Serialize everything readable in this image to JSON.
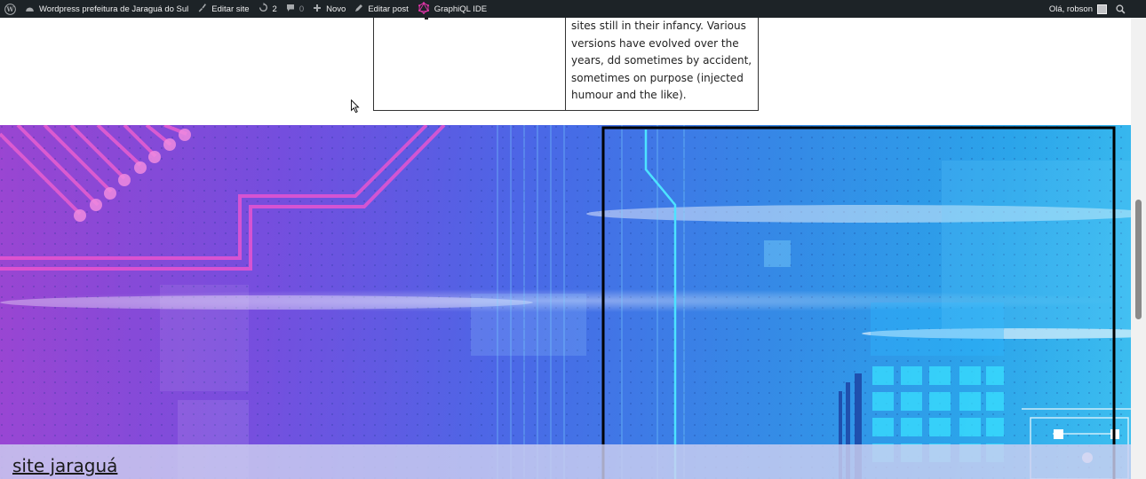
{
  "admin_bar": {
    "wp_logo_icon": "wordpress-icon",
    "site_name": "Wordpress prefeitura de Jaraguá do Sul",
    "edit_site": "Editar site",
    "updates_count": "2",
    "comments_count": "0",
    "new_label": "Novo",
    "edit_post": "Editar post",
    "graphiql": "GraphiQL IDE",
    "greeting": "Olá, robson"
  },
  "table": {
    "right_cell_text": "sites still in their infancy. Various versions have evolved over the years, dd sometimes by accident, sometimes on purpose (injected humour and the like)."
  },
  "hero": {
    "site_title": "site jaraguá"
  },
  "colors": {
    "admin_bar_bg": "#1d2327",
    "graphiql_accent": "#e535ab"
  }
}
